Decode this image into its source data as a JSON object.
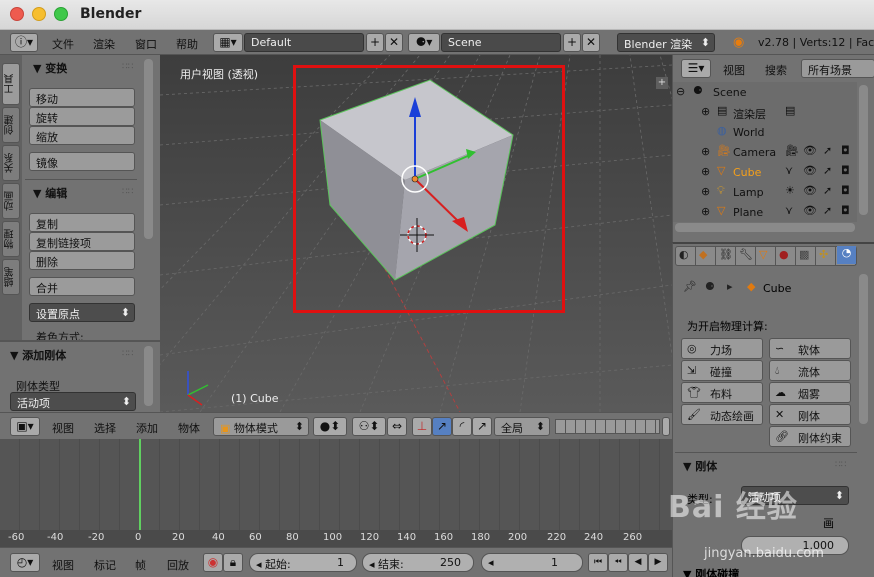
{
  "window": {
    "title": "Blender"
  },
  "topbar": {
    "menus": [
      "文件",
      "渲染",
      "窗口",
      "帮助"
    ],
    "layout": "Default",
    "scene": "Scene",
    "engine": "Blender 渲染",
    "stats": "v2.78 | Verts:12 | Face"
  },
  "toolshelf": {
    "tabs": [
      "工具",
      "创建",
      "关系",
      "动画",
      "物理",
      "蜡笔"
    ],
    "transform_header": "▼ 变换",
    "transform_buttons": [
      "移动",
      "旋转",
      "缩放"
    ],
    "mirror_button": "镜像",
    "edit_header": "▼ 编辑",
    "edit_buttons": [
      "复制",
      "复制链接项",
      "删除"
    ],
    "join_button": "合并",
    "origin_dropdown": "设置原点",
    "shading_label": "着色方式:",
    "rigid_header": "▼ 添加刚体",
    "rigid_type_label": "刚体类型",
    "rigid_type_value": "活动项"
  },
  "viewport": {
    "label": "用户视图 (透视)",
    "object": "(1) Cube"
  },
  "viewheader": {
    "menus": [
      "视图",
      "选择",
      "添加",
      "物体"
    ],
    "mode": "物体模式",
    "orientation": "全局"
  },
  "timeline": {
    "ticks": [
      "-60",
      "-40",
      "-20",
      "0",
      "20",
      "40",
      "60",
      "80",
      "100",
      "120",
      "140",
      "160",
      "180",
      "200",
      "220",
      "240",
      "260"
    ],
    "menus": [
      "视图",
      "标记",
      "帧",
      "回放"
    ],
    "start_label": "起始:",
    "start_value": "1",
    "end_label": "结束:",
    "end_value": "250",
    "current_frame": "1"
  },
  "outliner": {
    "menus": [
      "视图",
      "搜索"
    ],
    "filter": "所有场景",
    "rows": [
      {
        "label": "Scene"
      },
      {
        "label": "渲染层"
      },
      {
        "label": "World"
      },
      {
        "label": "Camera"
      },
      {
        "label": "Cube"
      },
      {
        "label": "Lamp"
      },
      {
        "label": "Plane"
      }
    ]
  },
  "properties": {
    "context_object": "Cube",
    "physics_label": "为开启物理计算:",
    "buttons": [
      "力场",
      "软体",
      "碰撞",
      "流体",
      "布料",
      "烟雾",
      "动态绘画",
      "刚体",
      "刚体约束"
    ],
    "rigid_header": "▼ 刚体",
    "type_label": "类型:",
    "type_value": "活动项",
    "anim_partial": "画",
    "value_partial": "1.000",
    "footer_partial": "▼ 刚体碰撞"
  },
  "watermark": {
    "site": "jingyan.baidu.com",
    "brand": "Bai 经验"
  },
  "colors": {
    "accent_red": "#e01010",
    "selected_blue": "#5680c2",
    "frame_green": "#60d060"
  }
}
